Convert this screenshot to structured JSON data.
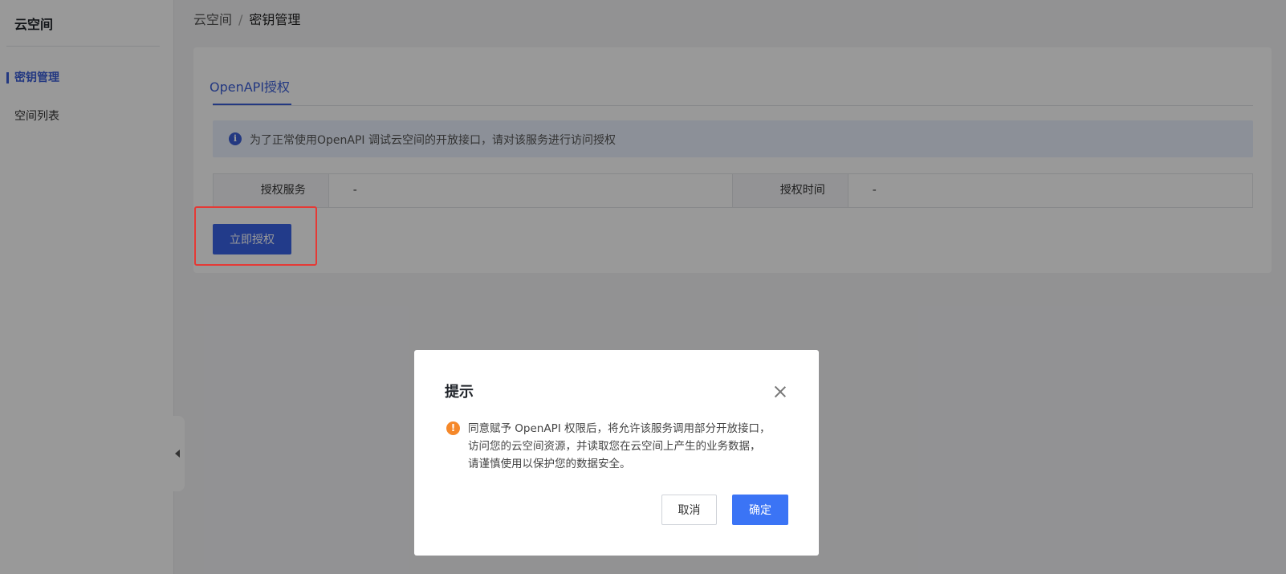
{
  "sidebar": {
    "title": "云空间",
    "items": [
      {
        "label": "密钥管理",
        "active": true
      },
      {
        "label": "空间列表",
        "active": false
      }
    ]
  },
  "breadcrumb": {
    "root": "云空间",
    "separator": "/",
    "current": "密钥管理"
  },
  "tabs": [
    {
      "label": "OpenAPI授权",
      "active": true
    }
  ],
  "info_bar": {
    "icon": "info-icon",
    "text": "为了正常使用OpenAPI 调试云空间的开放接口，请对该服务进行访问授权"
  },
  "auth_table": {
    "service_label": "授权服务",
    "service_value": "-",
    "time_label": "授权时间",
    "time_value": "-"
  },
  "authorize_button": "立即授权",
  "dialog": {
    "title": "提示",
    "warning_icon": "warning-icon",
    "lines": [
      "同意赋予 OpenAPI 权限后，将允许该服务调用部分开放接口，",
      "访问您的云空间资源，并读取您在云空间上产生的业务数据，",
      "请谨慎使用以保护您的数据安全。"
    ],
    "cancel_label": "取消",
    "ok_label": "确定"
  },
  "colors": {
    "primary": "#3b5ed8",
    "button_primary": "#3a63e6",
    "dialog_ok": "#3b74f5",
    "warning": "#f5882a",
    "highlight": "#e53935"
  }
}
